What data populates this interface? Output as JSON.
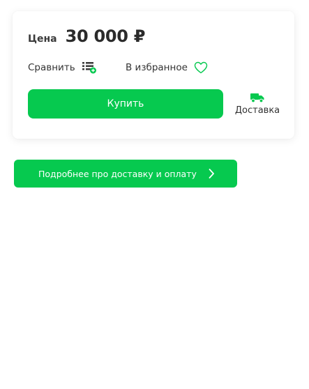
{
  "colors": {
    "accent": "#06c94f",
    "text": "#2d2d2d",
    "button_text": "#ffffff"
  },
  "price": {
    "label": "Цена",
    "value": "30 000 ₽"
  },
  "actions": {
    "compare_label": "Сравнить",
    "compare_icon": "compare-list-icon",
    "favorite_label": "В избранное",
    "favorite_icon": "heart-icon"
  },
  "buy": {
    "label": "Купить"
  },
  "delivery": {
    "label": "Доставка",
    "icon": "truck-icon"
  },
  "details": {
    "label": "Подробнее про доставку и оплату",
    "icon": "chevron-right-icon"
  }
}
